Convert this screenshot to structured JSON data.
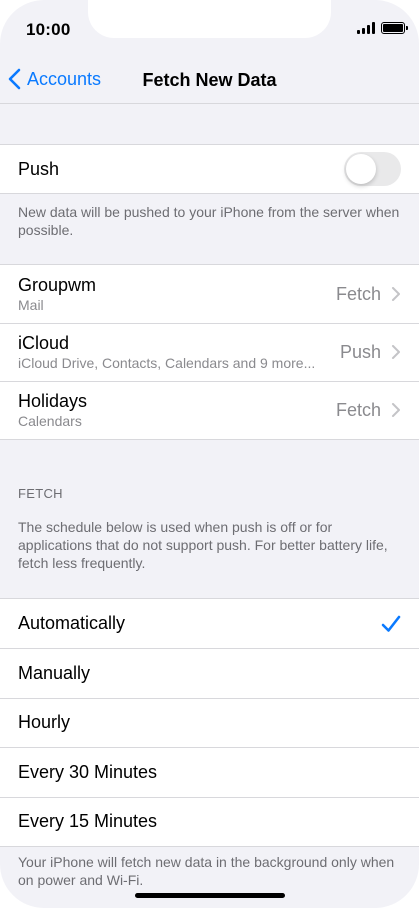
{
  "status_bar": {
    "time": "10:00"
  },
  "navbar": {
    "back_label": "Accounts",
    "title": "Fetch New Data"
  },
  "push": {
    "label": "Push",
    "enabled": false,
    "footnote": "New data will be pushed to your iPhone from the server when possible."
  },
  "accounts": [
    {
      "name": "Groupwm",
      "detail": "Mail",
      "value": "Fetch"
    },
    {
      "name": "iCloud",
      "detail": "iCloud Drive, Contacts, Calendars and 9 more...",
      "value": "Push"
    },
    {
      "name": "Holidays",
      "detail": "Calendars",
      "value": "Fetch"
    }
  ],
  "fetch": {
    "header": "FETCH",
    "description": "The schedule below is used when push is off or for applications that do not support push. For better battery life, fetch less frequently.",
    "options": [
      "Automatically",
      "Manually",
      "Hourly",
      "Every 30 Minutes",
      "Every 15 Minutes"
    ],
    "selected": "Automatically",
    "footnote": "Your iPhone will fetch new data in the background only when on power and Wi-Fi."
  },
  "colors": {
    "accent": "#0a7aff",
    "background": "#f2f2f7",
    "secondary_text": "#8a8a8e"
  }
}
